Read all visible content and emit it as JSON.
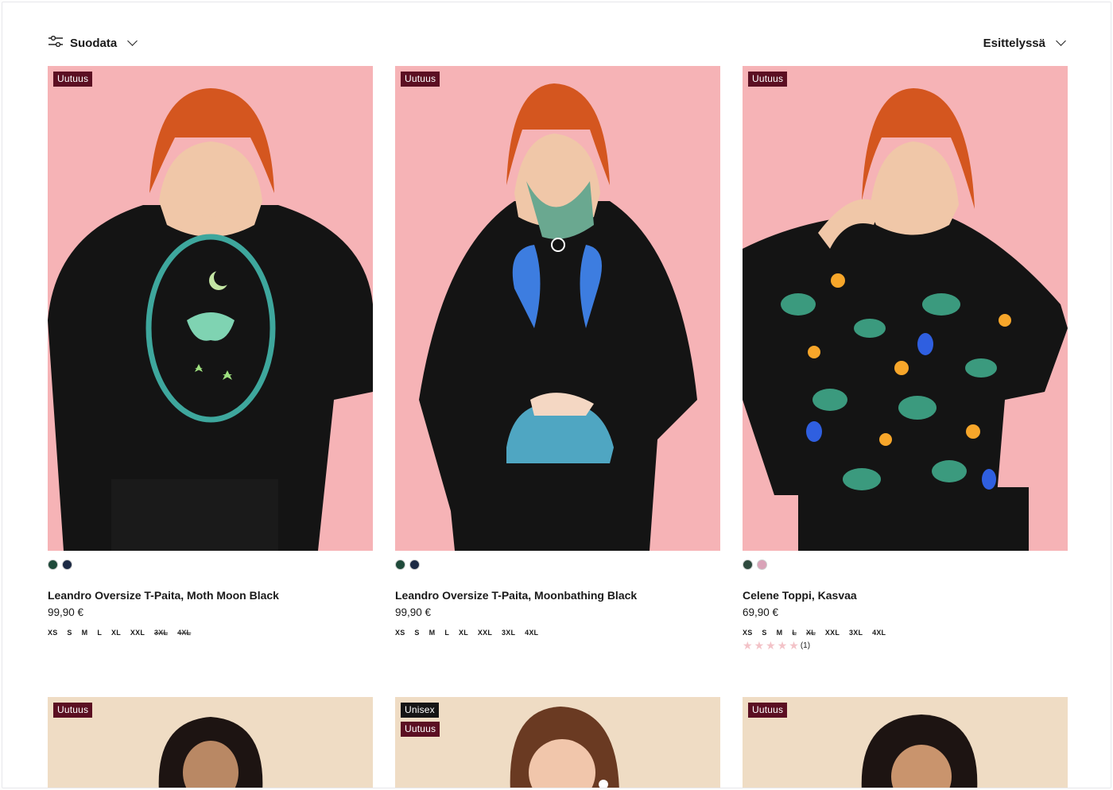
{
  "toolbar": {
    "filter_label": "Suodata",
    "sort_label": "Esittelyssä"
  },
  "products": [
    {
      "badges": [
        "Uutuus"
      ],
      "title": "Leandro Oversize T-Paita, Moth Moon Black",
      "price": "99,90 €",
      "swatch_colors": [
        "#1f4a3a",
        "#1c2a44"
      ],
      "sizes": [
        {
          "label": "XS",
          "available": true
        },
        {
          "label": "S",
          "available": true
        },
        {
          "label": "M",
          "available": true
        },
        {
          "label": "L",
          "available": true
        },
        {
          "label": "XL",
          "available": true
        },
        {
          "label": "XXL",
          "available": true
        },
        {
          "label": "3XL",
          "available": false
        },
        {
          "label": "4XL",
          "available": false
        }
      ]
    },
    {
      "badges": [
        "Uutuus"
      ],
      "title": "Leandro Oversize T-Paita, Moonbathing Black",
      "price": "99,90 €",
      "swatch_colors": [
        "#1f4a3a",
        "#1c2a44"
      ],
      "sizes": [
        {
          "label": "XS",
          "available": true
        },
        {
          "label": "S",
          "available": true
        },
        {
          "label": "M",
          "available": true
        },
        {
          "label": "L",
          "available": true
        },
        {
          "label": "XL",
          "available": true
        },
        {
          "label": "XXL",
          "available": true
        },
        {
          "label": "3XL",
          "available": true
        },
        {
          "label": "4XL",
          "available": true
        }
      ]
    },
    {
      "badges": [
        "Uutuus"
      ],
      "title": "Celene Toppi, Kasvaa",
      "price": "69,90 €",
      "swatch_colors": [
        "#2e4a3e",
        "#d9a3b8"
      ],
      "sizes": [
        {
          "label": "XS",
          "available": true
        },
        {
          "label": "S",
          "available": true
        },
        {
          "label": "M",
          "available": true
        },
        {
          "label": "L",
          "available": false
        },
        {
          "label": "XL",
          "available": false
        },
        {
          "label": "XXL",
          "available": true
        },
        {
          "label": "3XL",
          "available": true
        },
        {
          "label": "4XL",
          "available": true
        }
      ],
      "rating": {
        "stars": 5,
        "count": "(1)"
      }
    }
  ],
  "row2_badges": [
    [
      "Uutuus"
    ],
    [
      "Unisex",
      "Uutuus"
    ],
    [
      "Uutuus"
    ]
  ],
  "colors": {
    "badge_new": "#5b0f22",
    "badge_unisex": "#151515",
    "photo_bg": "#f6b3b6",
    "photo_bg2": "#efdcc4"
  }
}
